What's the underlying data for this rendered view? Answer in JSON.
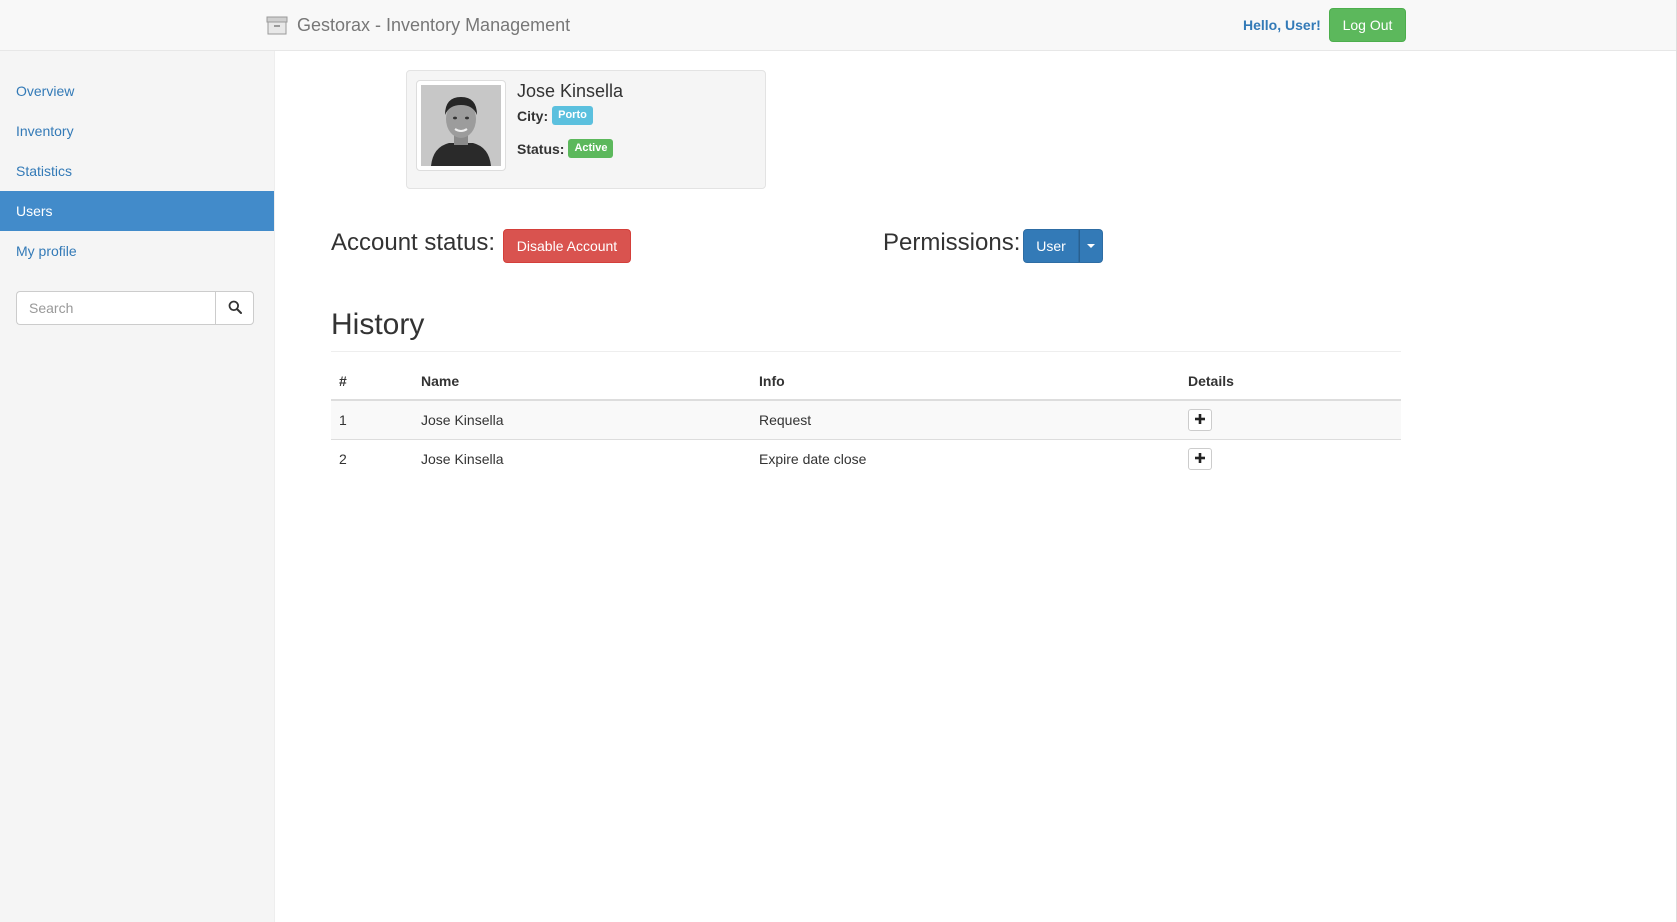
{
  "navbar": {
    "brand_icon": "archive-box-icon",
    "brand_text": "Gestorax - Inventory Management",
    "greeting": "Hello, User!",
    "logout_label": "Log Out"
  },
  "sidebar": {
    "items": [
      {
        "label": "Overview",
        "active": false
      },
      {
        "label": "Inventory",
        "active": false
      },
      {
        "label": "Statistics",
        "active": false
      },
      {
        "label": "Users",
        "active": true
      },
      {
        "label": "My profile",
        "active": false
      }
    ],
    "search": {
      "placeholder": "Search",
      "value": "",
      "icon": "search-icon"
    }
  },
  "profile": {
    "name": "Jose Kinsella",
    "city_label": "City:",
    "city": "Porto",
    "status_label": "Status:",
    "status": "Active"
  },
  "account": {
    "status_label": "Account status:",
    "disable_button": "Disable Account",
    "permissions_label": "Permissions:",
    "permission_value": "User"
  },
  "history": {
    "title": "History",
    "columns": [
      "#",
      "Name",
      "Info",
      "Details"
    ],
    "rows": [
      {
        "num": "1",
        "name": "Jose Kinsella",
        "info": "Request"
      },
      {
        "num": "2",
        "name": "Jose Kinsella",
        "info": "Expire date close"
      }
    ]
  },
  "colors": {
    "primary": "#337ab7",
    "success": "#5cb85c",
    "danger": "#d9534f",
    "info": "#5bc0de"
  }
}
